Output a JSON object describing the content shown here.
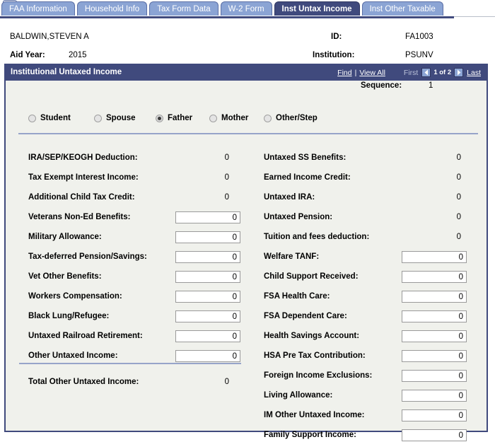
{
  "tabs": [
    {
      "label": "FAA Information",
      "active": false
    },
    {
      "label": "Household Info",
      "active": false
    },
    {
      "label": "Tax Form Data",
      "active": false
    },
    {
      "label": "W-2 Form",
      "active": false
    },
    {
      "label": "Inst Untax Income",
      "active": true
    },
    {
      "label": "Inst Other Taxable",
      "active": false
    }
  ],
  "tab_next_icon": "next-tab-arrow-icon",
  "person": {
    "name": "BALDWIN,STEVEN A",
    "aid_year_label": "Aid Year:",
    "aid_year_value": "2015",
    "id_label": "ID:",
    "id_value": "FA1003",
    "institution_label": "Institution:",
    "institution_value": "PSUNV"
  },
  "group": {
    "title": "Institutional Untaxed Income",
    "find_label": "Find",
    "separator": "|",
    "view_all_label": "View All",
    "first_label": "First",
    "prev_icon": "previous-arrow-icon",
    "count_label": "1 of 2",
    "next_icon": "next-arrow-icon",
    "last_label": "Last"
  },
  "parent_selector": {
    "options": [
      {
        "label": "Student",
        "checked": false
      },
      {
        "label": "Spouse",
        "checked": false
      },
      {
        "label": "Father",
        "checked": true
      },
      {
        "label": "Mother",
        "checked": false
      },
      {
        "label": "Other/Step",
        "checked": false
      }
    ],
    "sequence_label": "Sequence:",
    "sequence_value": "1"
  },
  "left_column": [
    {
      "label": "IRA/SEP/KEOGH Deduction:",
      "value": "0",
      "editable": false
    },
    {
      "label": "Tax Exempt Interest Income:",
      "value": "0",
      "editable": false
    },
    {
      "label": "Additional Child Tax Credit:",
      "value": "0",
      "editable": false
    },
    {
      "label": "Veterans Non-Ed Benefits:",
      "value": "0",
      "editable": true
    },
    {
      "label": "Military Allowance:",
      "value": "0",
      "editable": true
    },
    {
      "label": "Tax-deferred Pension/Savings:",
      "value": "0",
      "editable": true
    },
    {
      "label": "Vet Other Benefits:",
      "value": "0",
      "editable": true
    },
    {
      "label": "Workers Compensation:",
      "value": "0",
      "editable": true
    },
    {
      "label": "Black Lung/Refugee:",
      "value": "0",
      "editable": true
    },
    {
      "label": "Untaxed Railroad Retirement:",
      "value": "0",
      "editable": true
    },
    {
      "label": "Other Untaxed Income:",
      "value": "0",
      "editable": true
    }
  ],
  "left_total": {
    "label": "Total Other Untaxed Income:",
    "value": "0"
  },
  "right_column": [
    {
      "label": "Untaxed SS Benefits:",
      "value": "0",
      "editable": false
    },
    {
      "label": "Earned Income Credit:",
      "value": "0",
      "editable": false
    },
    {
      "label": "Untaxed IRA:",
      "value": "0",
      "editable": false
    },
    {
      "label": "Untaxed Pension:",
      "value": "0",
      "editable": false
    },
    {
      "label": "Tuition and fees deduction:",
      "value": "0",
      "editable": false
    },
    {
      "label": "Welfare TANF:",
      "value": "0",
      "editable": true
    },
    {
      "label": "Child Support Received:",
      "value": "0",
      "editable": true
    },
    {
      "label": "FSA Health Care:",
      "value": "0",
      "editable": true
    },
    {
      "label": "FSA Dependent Care:",
      "value": "0",
      "editable": true
    },
    {
      "label": "Health Savings Account:",
      "value": "0",
      "editable": true
    },
    {
      "label": "HSA Pre Tax Contribution:",
      "value": "0",
      "editable": true
    },
    {
      "label": "Foreign Income Exclusions:",
      "value": "0",
      "editable": true
    },
    {
      "label": "Living Allowance:",
      "value": "0",
      "editable": true
    },
    {
      "label": "IM Other Untaxed Income:",
      "value": "0",
      "editable": true
    },
    {
      "label": "Family Support Income:",
      "value": "0",
      "editable": true
    }
  ],
  "colors": {
    "tab_inactive": "#8ba4d4",
    "tab_active": "#404a7d",
    "header_bar": "#404a7d",
    "panel_bg": "#f0f1ec",
    "separator": "#97a4c9"
  }
}
